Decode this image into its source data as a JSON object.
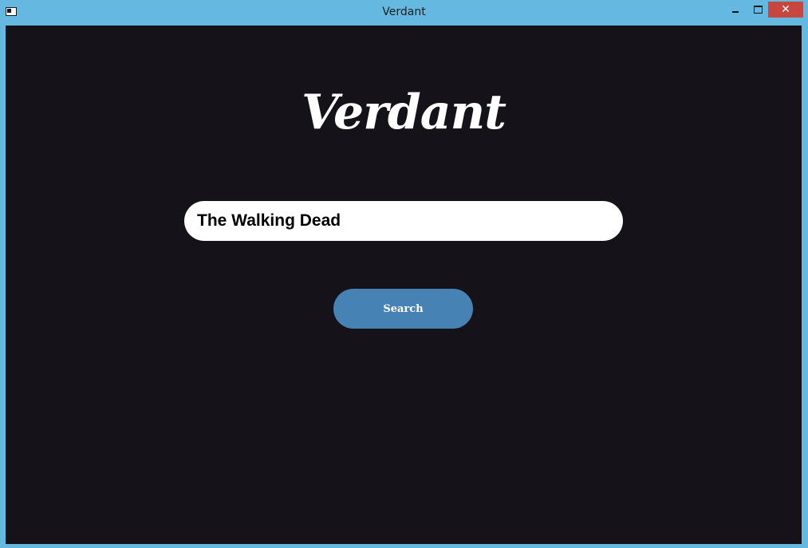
{
  "window": {
    "title": "Verdant",
    "close_label": "✕",
    "titlebar_color": "#65b9e0",
    "close_color": "#c7463f"
  },
  "main": {
    "brand": "Verdant",
    "background_color": "#15121a",
    "search": {
      "value": "The Walking Dead",
      "placeholder": ""
    },
    "search_button_label": "Search",
    "button_color": "#4682b4"
  }
}
